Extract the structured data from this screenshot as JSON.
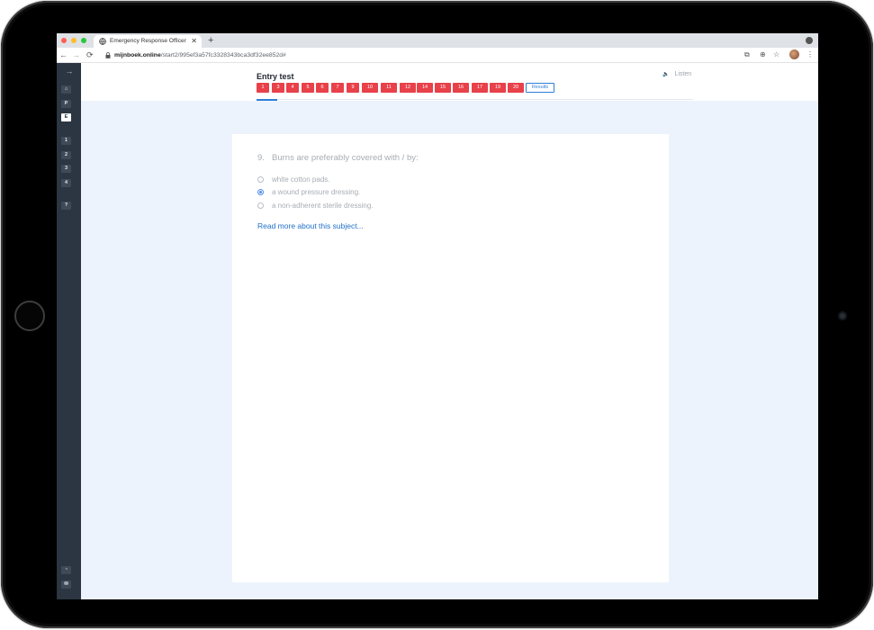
{
  "browser": {
    "tab_title": "Emergency Response Officer",
    "tab_close": "✕",
    "new_tab": "+",
    "url_domain": "mijnboek.online",
    "url_path": "/start2/995ef3a57fc3328343bca3df32ee852d#",
    "nav": {
      "back": "←",
      "forward": "→",
      "reload": "⟳"
    },
    "icons": {
      "translate": "⧉",
      "zoom": "⊕",
      "bookmark": "☆",
      "menu": "⋮"
    }
  },
  "sidebar": {
    "collapse_icon": "→",
    "home_icon": "⌂",
    "items": [
      "P",
      "E"
    ],
    "chapters": [
      "1",
      "2",
      "3",
      "4"
    ],
    "help": "?",
    "bottom_icons": [
      "◔",
      "✉"
    ]
  },
  "header": {
    "title": "Entry test",
    "listen_icon": "🔈",
    "listen_label": "Listen",
    "question_numbers": [
      "1",
      "3",
      "4",
      "5",
      "6",
      "7",
      "9",
      "10",
      "11",
      "12",
      "14",
      "15",
      "16",
      "17",
      "19",
      "20"
    ],
    "results_label": "Results"
  },
  "question": {
    "number": "9.",
    "text": "Burns are preferably covered with / by:",
    "options": [
      {
        "label": "white cotton pads.",
        "selected": false
      },
      {
        "label": "a wound pressure dressing.",
        "selected": true
      },
      {
        "label": "a non-adherent sterile dressing.",
        "selected": false
      }
    ],
    "read_more": "Read more about this subject..."
  },
  "colors": {
    "accent": "#2f7fd6",
    "question_button": "#e8414a",
    "sidebar": "#2b3642",
    "app_background": "#edf3fc"
  }
}
